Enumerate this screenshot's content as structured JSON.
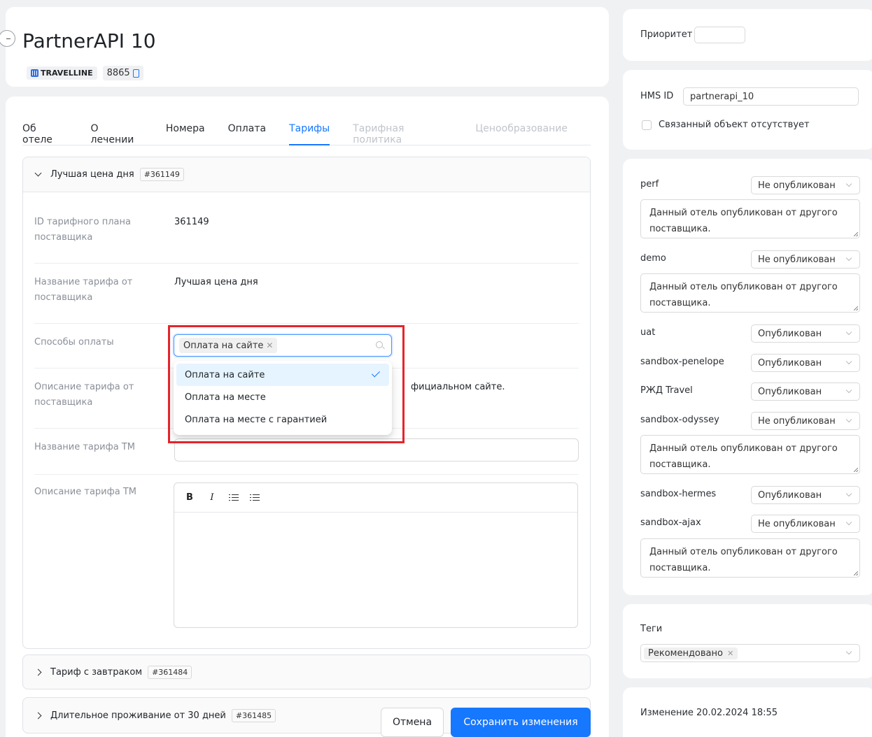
{
  "header": {
    "title": "PartnerAPI 10",
    "provider_name": "TRAVELLINE",
    "provider_id": "8865"
  },
  "tabs": [
    {
      "label": "Об отеле",
      "state": "normal"
    },
    {
      "label": "О лечении",
      "state": "normal"
    },
    {
      "label": "Номера",
      "state": "normal"
    },
    {
      "label": "Оплата",
      "state": "normal"
    },
    {
      "label": "Тарифы",
      "state": "active"
    },
    {
      "label": "Тарифная политика",
      "state": "disabled"
    },
    {
      "label": "Ценообразование",
      "state": "disabled"
    }
  ],
  "tariff_panel": {
    "title": "Лучшая цена дня",
    "id_tag": "#361149",
    "fields": {
      "plan_id_label": "ID тарифного плана поставщика",
      "plan_id_value": "361149",
      "name_label": "Название тарифа от поставщика",
      "name_value": "Лучшая цена дня",
      "payment_label": "Способы оплаты",
      "description_label": "Описание тарифа от поставщика",
      "description_value_fragment": "фициальном сайте.",
      "tm_name_label": "Название тарифа ТМ",
      "tm_description_label": "Описание тарифа ТМ"
    },
    "payment_select": {
      "selected_tag": "Оплата на сайте",
      "options": [
        {
          "label": "Оплата на сайте",
          "selected": true
        },
        {
          "label": "Оплата на месте",
          "selected": false
        },
        {
          "label": "Оплата на месте с гарантией",
          "selected": false
        }
      ]
    },
    "editor_toolbar": {
      "bold": "B",
      "italic": "I"
    }
  },
  "collapsed_panels": [
    {
      "title": "Тариф с завтраком",
      "id_tag": "#361484"
    },
    {
      "title": "Длительное проживание от 30 дней",
      "id_tag": "#361485"
    }
  ],
  "actions": {
    "cancel": "Отмена",
    "save": "Сохранить изменения"
  },
  "sidebar": {
    "priority_label": "Приоритет",
    "priority_value": "",
    "hms_label": "HMS ID",
    "hms_value": "partnerapi_10",
    "no_linked_label": "Связанный объект отсутствует",
    "publications": [
      {
        "name": "perf",
        "status": "Не опубликован",
        "note": "Данный отель опубликован от другого поставщика."
      },
      {
        "name": "demo",
        "status": "Не опубликован",
        "note": "Данный отель опубликован от другого поставщика."
      },
      {
        "name": "uat",
        "status": "Опубликован",
        "note": null
      },
      {
        "name": "sandbox-penelope",
        "status": "Опубликован",
        "note": null
      },
      {
        "name": "РЖД Travel",
        "status": "Опубликован",
        "note": null
      },
      {
        "name": "sandbox-odyssey",
        "status": "Не опубликован",
        "note": "Данный отель опубликован от другого поставщика."
      },
      {
        "name": "sandbox-hermes",
        "status": "Опубликован",
        "note": null
      },
      {
        "name": "sandbox-ajax",
        "status": "Не опубликован",
        "note": "Данный отель опубликован от другого поставщика."
      }
    ],
    "tags_label": "Теги",
    "tags": [
      "Рекомендовано"
    ],
    "changed_text": "Изменение 20.02.2024 18:55"
  },
  "colors": {
    "accent": "#1677ff",
    "highlight": "#e5242c",
    "background": "#f0f1f3"
  }
}
